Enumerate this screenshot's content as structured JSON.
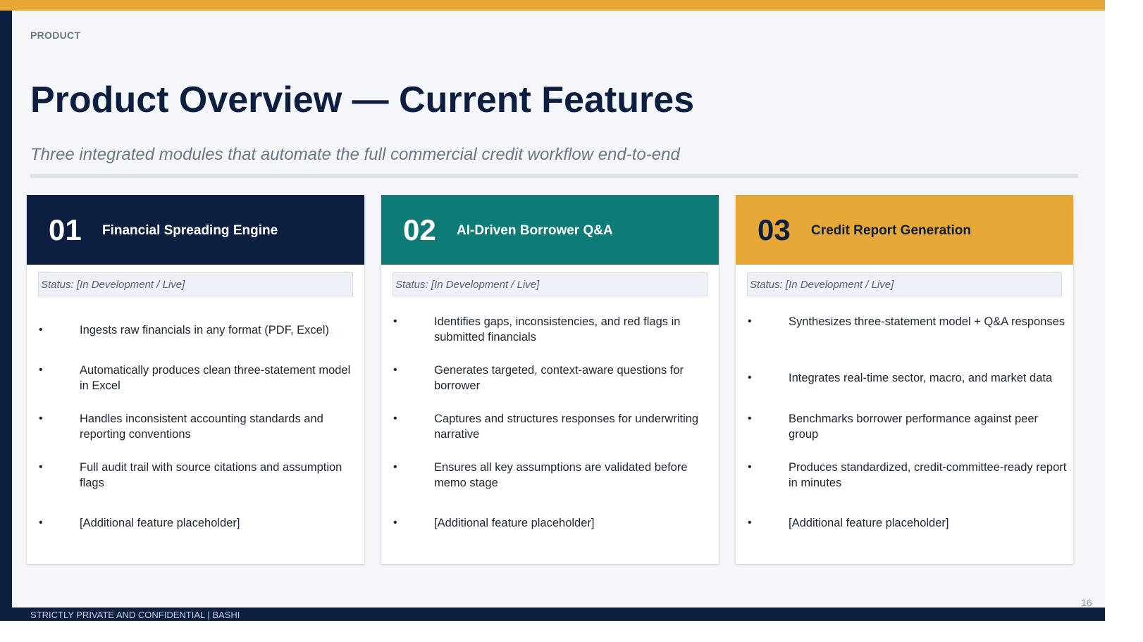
{
  "header": {
    "section_tag": "PRODUCT",
    "title": "Product Overview — Current Features",
    "subtitle": "Three integrated modules that automate the full commercial credit workflow end-to-end"
  },
  "colors": {
    "navy": "#0d1f40",
    "teal": "#0e7b76",
    "gold": "#e8a838"
  },
  "cards": [
    {
      "number": "01",
      "title": "Financial Spreading Engine",
      "status": "Status: [In Development / Live]",
      "bullets": [
        "Ingests raw financials in any format (PDF, Excel)",
        "Automatically produces clean three-statement model in Excel",
        "Handles inconsistent accounting standards and reporting conventions",
        "Full audit trail with source citations and assumption flags",
        "[Additional feature placeholder]"
      ]
    },
    {
      "number": "02",
      "title": "AI-Driven Borrower Q&A",
      "status": "Status: [In Development / Live]",
      "bullets": [
        "Identifies gaps, inconsistencies, and red flags in submitted financials",
        "Generates targeted, context-aware questions for borrower",
        "Captures and structures responses for underwriting narrative",
        "Ensures all key assumptions are validated before memo stage",
        "[Additional feature placeholder]"
      ]
    },
    {
      "number": "03",
      "title": "Credit Report Generation",
      "status": "Status: [In Development / Live]",
      "bullets": [
        "Synthesizes three-statement model + Q&A responses",
        "Integrates real-time sector, macro, and market data",
        "Benchmarks borrower performance against peer group",
        "Produces standardized, credit-committee-ready report in minutes",
        "[Additional feature placeholder]"
      ]
    }
  ],
  "footer": {
    "text": "STRICTLY PRIVATE AND CONFIDENTIAL  |  BASHI",
    "page_number": "16"
  }
}
